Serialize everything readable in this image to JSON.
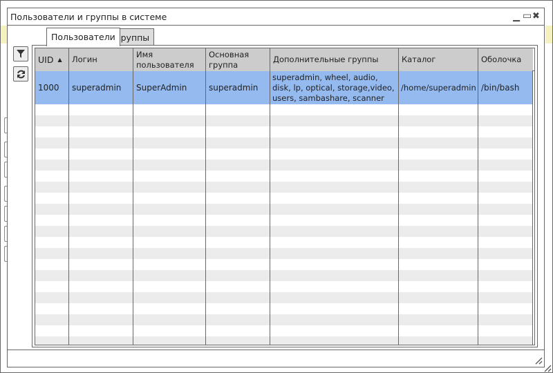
{
  "window": {
    "title": "Пользователи и группы в системе",
    "minimize": "▁",
    "maximize": "▭",
    "close": "✖"
  },
  "tabs": [
    {
      "label": "Пользователи",
      "active": true
    },
    {
      "label": "Группы",
      "active": false
    }
  ],
  "toolbar": {
    "filter_icon": "filter-icon",
    "refresh_icon": "refresh-icon"
  },
  "table": {
    "columns": [
      {
        "label": "UID",
        "sort": "ascending"
      },
      {
        "label": "Логин"
      },
      {
        "label": "Имя пользователя"
      },
      {
        "label": "Основная группа"
      },
      {
        "label": "Дополнительные группы"
      },
      {
        "label": "Каталог"
      },
      {
        "label": "Оболочка"
      }
    ],
    "rows": [
      {
        "uid": "1000",
        "login": "superadmin",
        "name": "SuperAdmin",
        "primary_group": "superadmin",
        "extra_groups": "superadmin, wheel, audio, disk, lp, optical, storage,video, users, sambashare, scanner",
        "home": "/home/superadmin",
        "shell": "/bin/bash",
        "selected": true
      }
    ]
  },
  "colors": {
    "selected_row": "#94baf0",
    "header": "#cccccc",
    "stripe": "#ececec",
    "accent_yellow": "#f5f2c0"
  }
}
